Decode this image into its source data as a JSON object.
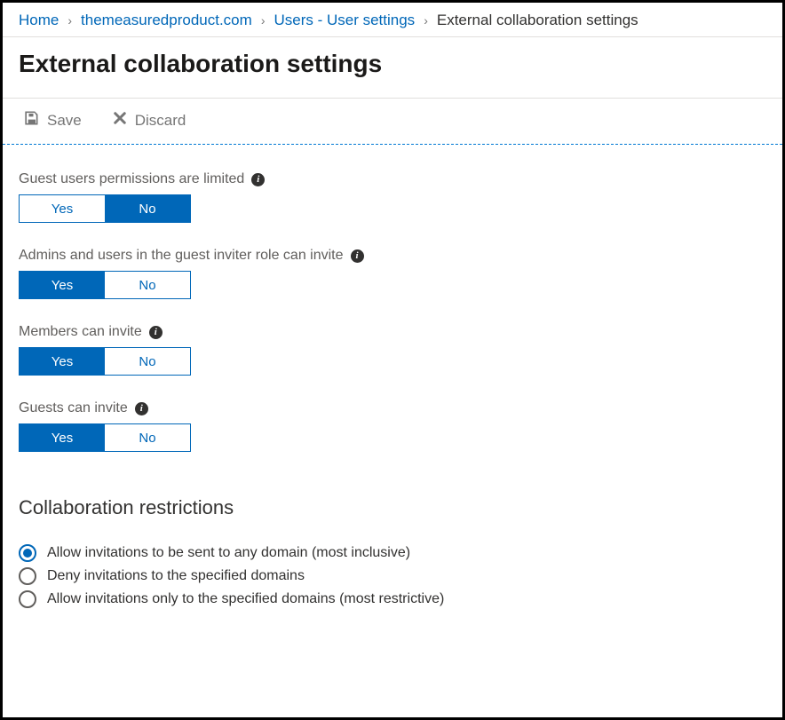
{
  "breadcrumb": {
    "items": [
      {
        "label": "Home",
        "link": true
      },
      {
        "label": "themeasuredproduct.com",
        "link": true
      },
      {
        "label": "Users - User settings",
        "link": true
      },
      {
        "label": "External collaboration settings",
        "link": false
      }
    ]
  },
  "page_title": "External collaboration settings",
  "toolbar": {
    "save_label": "Save",
    "discard_label": "Discard"
  },
  "toggle_labels": {
    "yes": "Yes",
    "no": "No"
  },
  "settings": [
    {
      "label": "Guest users permissions are limited",
      "value": "No"
    },
    {
      "label": "Admins and users in the guest inviter role can invite",
      "value": "Yes"
    },
    {
      "label": "Members can invite",
      "value": "Yes"
    },
    {
      "label": "Guests can invite",
      "value": "Yes"
    }
  ],
  "restrictions": {
    "title": "Collaboration restrictions",
    "options": [
      {
        "label": "Allow invitations to be sent to any domain (most inclusive)",
        "selected": true
      },
      {
        "label": "Deny invitations to the specified domains",
        "selected": false
      },
      {
        "label": "Allow invitations only to the specified domains (most restrictive)",
        "selected": false
      }
    ]
  }
}
